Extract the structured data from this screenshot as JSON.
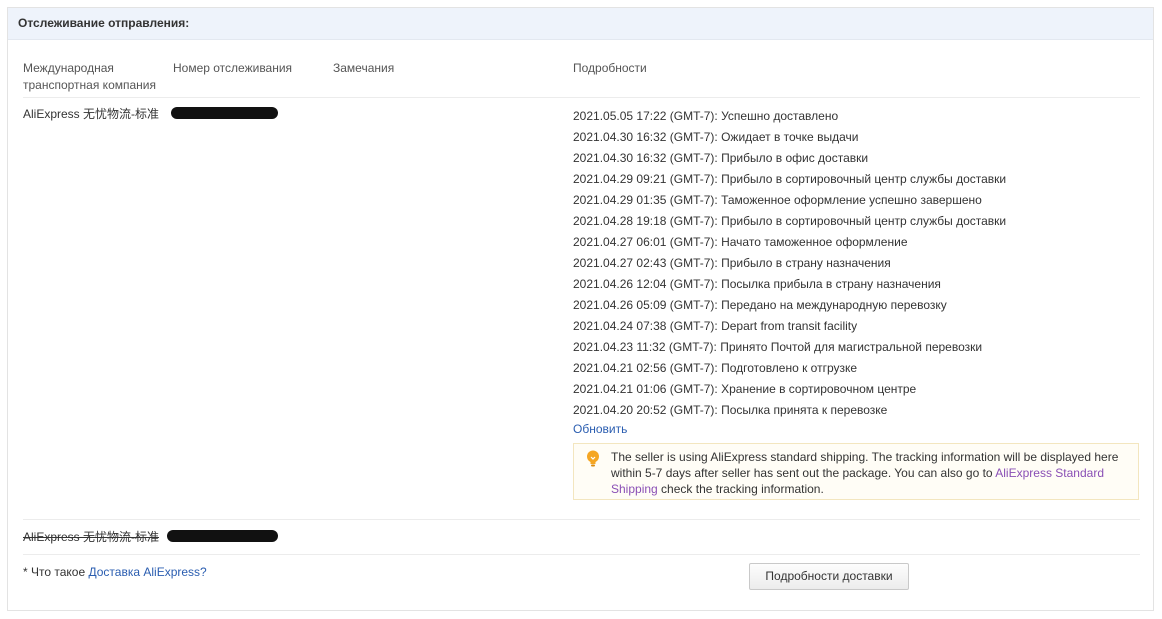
{
  "header": {
    "title": "Отслеживание отправления:"
  },
  "columns": {
    "carrier": "Международная транспортная компания",
    "tracking": "Номер отслеживания",
    "remarks": "Замечания",
    "details": "Подробности"
  },
  "shipment1": {
    "carrier": "AliExpress 无忧物流-标准",
    "events": [
      {
        "time": "2021.05.05 17:22 (GMT-7):",
        "text": "Успешно доставлено"
      },
      {
        "time": "2021.04.30 16:32 (GMT-7):",
        "text": "Ожидает в точке выдачи"
      },
      {
        "time": "2021.04.30 16:32 (GMT-7):",
        "text": "Прибыло в офис доставки"
      },
      {
        "time": "2021.04.29 09:21 (GMT-7):",
        "text": "Прибыло в сортировочный центр службы доставки"
      },
      {
        "time": "2021.04.29 01:35 (GMT-7):",
        "text": "Таможенное оформление успешно завершено"
      },
      {
        "time": "2021.04.28 19:18 (GMT-7):",
        "text": "Прибыло в сортировочный центр службы доставки"
      },
      {
        "time": "2021.04.27 06:01 (GMT-7):",
        "text": "Начато таможенное оформление"
      },
      {
        "time": "2021.04.27 02:43 (GMT-7):",
        "text": "Прибыло в страну назначения"
      },
      {
        "time": "2021.04.26 12:04 (GMT-7):",
        "text": "Посылка прибыла в страну назначения"
      },
      {
        "time": "2021.04.26 05:09 (GMT-7):",
        "text": "Передано на международную перевозку"
      },
      {
        "time": "2021.04.24 07:38 (GMT-7):",
        "text": "Depart from transit facility"
      },
      {
        "time": "2021.04.23 11:32 (GMT-7):",
        "text": "Принято Почтой для магистральной перевозки"
      },
      {
        "time": "2021.04.21 02:56 (GMT-7):",
        "text": "Подготовлено к отгрузке"
      },
      {
        "time": "2021.04.21 01:06 (GMT-7):",
        "text": "Хранение в сортировочном центре"
      },
      {
        "time": "2021.04.20 20:52 (GMT-7):",
        "text": "Посылка принята к перевозке"
      }
    ],
    "refresh_link": "Обновить",
    "notice": {
      "text_before": "The seller is using AliExpress standard shipping. The tracking information will be displayed here within 5-7 days after seller has sent out the package. You can also go to ",
      "link": "AliExpress Standard Shipping",
      "text_after": " check the tracking information."
    }
  },
  "shipment2": {
    "carrier": "AliExpress 无忧物流-标准"
  },
  "footer": {
    "question_prefix": "* Что такое ",
    "question_link": "Доставка AliExpress?",
    "button": "Подробности доставки"
  },
  "colors": {
    "header_bg": "#eef3fb",
    "link": "#2a5db0",
    "notice_link": "#8a4fb5",
    "bulb": "#f5a623"
  }
}
